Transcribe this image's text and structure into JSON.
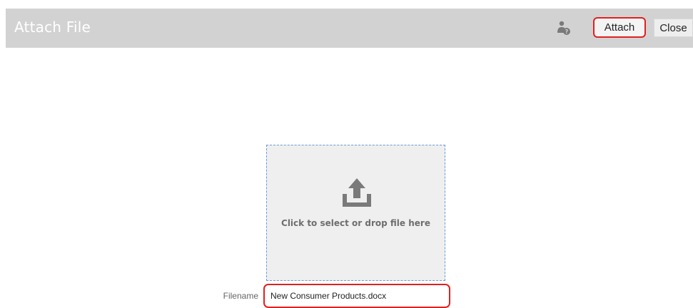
{
  "dialog": {
    "title": "Attach File"
  },
  "toolbar": {
    "help_icon": "user-help-icon",
    "attach_label": "Attach",
    "close_label": "Close",
    "attach_highlight_color": "#e02020"
  },
  "dropzone": {
    "icon": "upload-icon",
    "label": "Click to select or drop file here",
    "border_color": "#6a9ad8"
  },
  "filename": {
    "label": "Filename",
    "value": "New Consumer Products.docx"
  }
}
